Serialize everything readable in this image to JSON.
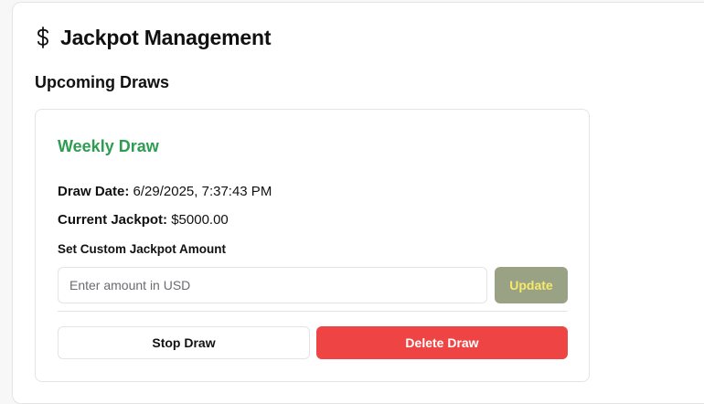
{
  "header": {
    "icon": "dollar-icon",
    "title": "Jackpot Management"
  },
  "section": {
    "title": "Upcoming Draws"
  },
  "draw": {
    "name": "Weekly Draw",
    "date_label": "Draw Date:",
    "date_value": "6/29/2025, 7:37:43 PM",
    "jackpot_label": "Current Jackpot:",
    "jackpot_value": "$5000.00",
    "custom_label": "Set Custom Jackpot Amount",
    "input_value": "",
    "input_placeholder": "Enter amount in USD",
    "update_label": "Update",
    "stop_label": "Stop Draw",
    "delete_label": "Delete Draw"
  },
  "colors": {
    "draw_name": "#2e9d52",
    "update_bg": "#9aa285",
    "update_text": "#f6ea6a",
    "delete_bg": "#ef4444"
  }
}
